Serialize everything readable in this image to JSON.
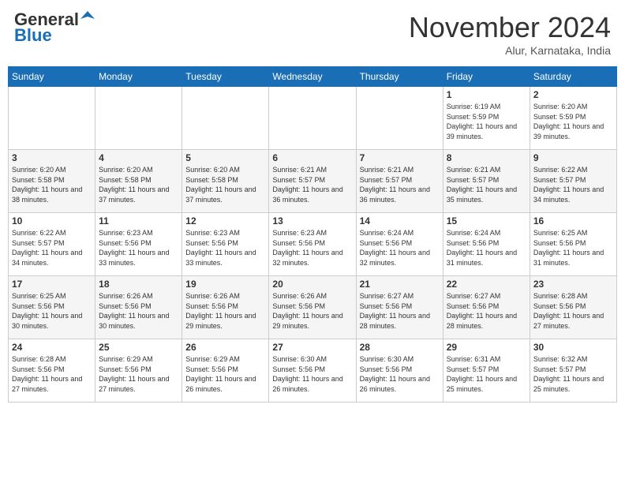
{
  "header": {
    "logo_line1": "General",
    "logo_line2": "Blue",
    "month": "November 2024",
    "location": "Alur, Karnataka, India"
  },
  "weekdays": [
    "Sunday",
    "Monday",
    "Tuesday",
    "Wednesday",
    "Thursday",
    "Friday",
    "Saturday"
  ],
  "weeks": [
    [
      {
        "day": "",
        "info": ""
      },
      {
        "day": "",
        "info": ""
      },
      {
        "day": "",
        "info": ""
      },
      {
        "day": "",
        "info": ""
      },
      {
        "day": "",
        "info": ""
      },
      {
        "day": "1",
        "info": "Sunrise: 6:19 AM\nSunset: 5:59 PM\nDaylight: 11 hours\nand 39 minutes."
      },
      {
        "day": "2",
        "info": "Sunrise: 6:20 AM\nSunset: 5:59 PM\nDaylight: 11 hours\nand 39 minutes."
      }
    ],
    [
      {
        "day": "3",
        "info": "Sunrise: 6:20 AM\nSunset: 5:58 PM\nDaylight: 11 hours\nand 38 minutes."
      },
      {
        "day": "4",
        "info": "Sunrise: 6:20 AM\nSunset: 5:58 PM\nDaylight: 11 hours\nand 37 minutes."
      },
      {
        "day": "5",
        "info": "Sunrise: 6:20 AM\nSunset: 5:58 PM\nDaylight: 11 hours\nand 37 minutes."
      },
      {
        "day": "6",
        "info": "Sunrise: 6:21 AM\nSunset: 5:57 PM\nDaylight: 11 hours\nand 36 minutes."
      },
      {
        "day": "7",
        "info": "Sunrise: 6:21 AM\nSunset: 5:57 PM\nDaylight: 11 hours\nand 36 minutes."
      },
      {
        "day": "8",
        "info": "Sunrise: 6:21 AM\nSunset: 5:57 PM\nDaylight: 11 hours\nand 35 minutes."
      },
      {
        "day": "9",
        "info": "Sunrise: 6:22 AM\nSunset: 5:57 PM\nDaylight: 11 hours\nand 34 minutes."
      }
    ],
    [
      {
        "day": "10",
        "info": "Sunrise: 6:22 AM\nSunset: 5:57 PM\nDaylight: 11 hours\nand 34 minutes."
      },
      {
        "day": "11",
        "info": "Sunrise: 6:23 AM\nSunset: 5:56 PM\nDaylight: 11 hours\nand 33 minutes."
      },
      {
        "day": "12",
        "info": "Sunrise: 6:23 AM\nSunset: 5:56 PM\nDaylight: 11 hours\nand 33 minutes."
      },
      {
        "day": "13",
        "info": "Sunrise: 6:23 AM\nSunset: 5:56 PM\nDaylight: 11 hours\nand 32 minutes."
      },
      {
        "day": "14",
        "info": "Sunrise: 6:24 AM\nSunset: 5:56 PM\nDaylight: 11 hours\nand 32 minutes."
      },
      {
        "day": "15",
        "info": "Sunrise: 6:24 AM\nSunset: 5:56 PM\nDaylight: 11 hours\nand 31 minutes."
      },
      {
        "day": "16",
        "info": "Sunrise: 6:25 AM\nSunset: 5:56 PM\nDaylight: 11 hours\nand 31 minutes."
      }
    ],
    [
      {
        "day": "17",
        "info": "Sunrise: 6:25 AM\nSunset: 5:56 PM\nDaylight: 11 hours\nand 30 minutes."
      },
      {
        "day": "18",
        "info": "Sunrise: 6:26 AM\nSunset: 5:56 PM\nDaylight: 11 hours\nand 30 minutes."
      },
      {
        "day": "19",
        "info": "Sunrise: 6:26 AM\nSunset: 5:56 PM\nDaylight: 11 hours\nand 29 minutes."
      },
      {
        "day": "20",
        "info": "Sunrise: 6:26 AM\nSunset: 5:56 PM\nDaylight: 11 hours\nand 29 minutes."
      },
      {
        "day": "21",
        "info": "Sunrise: 6:27 AM\nSunset: 5:56 PM\nDaylight: 11 hours\nand 28 minutes."
      },
      {
        "day": "22",
        "info": "Sunrise: 6:27 AM\nSunset: 5:56 PM\nDaylight: 11 hours\nand 28 minutes."
      },
      {
        "day": "23",
        "info": "Sunrise: 6:28 AM\nSunset: 5:56 PM\nDaylight: 11 hours\nand 27 minutes."
      }
    ],
    [
      {
        "day": "24",
        "info": "Sunrise: 6:28 AM\nSunset: 5:56 PM\nDaylight: 11 hours\nand 27 minutes."
      },
      {
        "day": "25",
        "info": "Sunrise: 6:29 AM\nSunset: 5:56 PM\nDaylight: 11 hours\nand 27 minutes."
      },
      {
        "day": "26",
        "info": "Sunrise: 6:29 AM\nSunset: 5:56 PM\nDaylight: 11 hours\nand 26 minutes."
      },
      {
        "day": "27",
        "info": "Sunrise: 6:30 AM\nSunset: 5:56 PM\nDaylight: 11 hours\nand 26 minutes."
      },
      {
        "day": "28",
        "info": "Sunrise: 6:30 AM\nSunset: 5:56 PM\nDaylight: 11 hours\nand 26 minutes."
      },
      {
        "day": "29",
        "info": "Sunrise: 6:31 AM\nSunset: 5:57 PM\nDaylight: 11 hours\nand 25 minutes."
      },
      {
        "day": "30",
        "info": "Sunrise: 6:32 AM\nSunset: 5:57 PM\nDaylight: 11 hours\nand 25 minutes."
      }
    ]
  ]
}
